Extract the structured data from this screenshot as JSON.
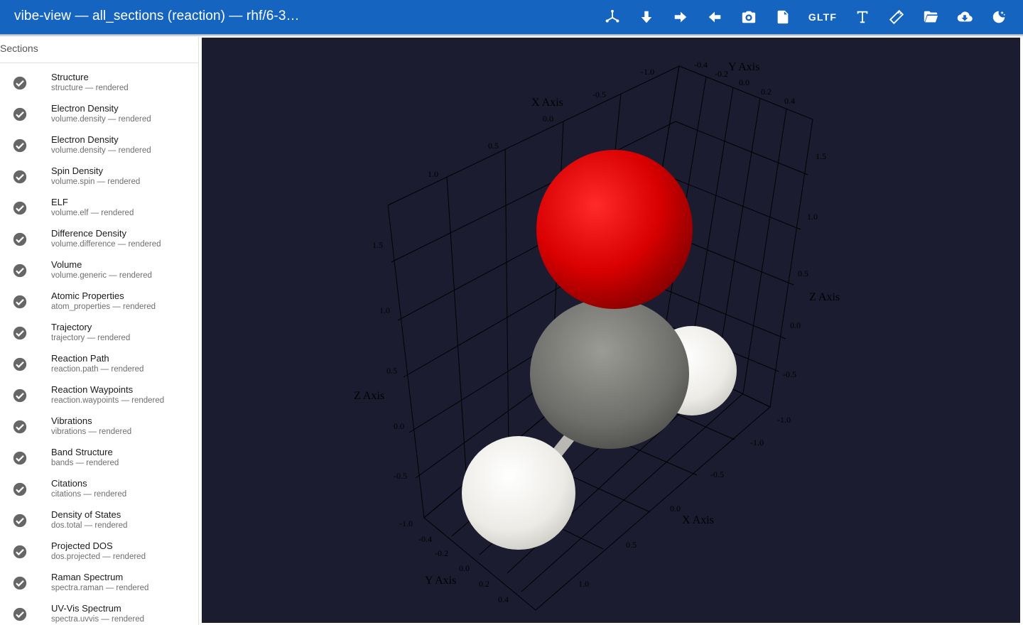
{
  "appbar": {
    "title": "vibe-view — all_sections (reaction) — rhf/6-3…",
    "toolbar": [
      {
        "name": "axes-button",
        "icon": "axes-icon"
      },
      {
        "name": "arrow-down-button",
        "icon": "arrow-down-icon"
      },
      {
        "name": "arrow-right-button",
        "icon": "arrow-right-icon"
      },
      {
        "name": "arrow-left-button",
        "icon": "arrow-left-icon"
      },
      {
        "name": "screenshot-button",
        "icon": "camera-icon"
      },
      {
        "name": "export-file-button",
        "icon": "file-export-icon"
      },
      {
        "name": "gltf-button",
        "label": "GLTF"
      },
      {
        "name": "text-button",
        "icon": "text-icon"
      },
      {
        "name": "measure-button",
        "icon": "ruler-icon"
      },
      {
        "name": "open-folder-button",
        "icon": "folder-open-icon"
      },
      {
        "name": "download-button",
        "icon": "cloud-download-icon"
      },
      {
        "name": "theme-button",
        "icon": "theme-icon"
      }
    ],
    "gltf_label": "GLTF"
  },
  "sidebar": {
    "header": "Sections",
    "items": [
      {
        "title": "Structure",
        "subtitle": "structure — rendered"
      },
      {
        "title": "Electron Density",
        "subtitle": "volume.density — rendered"
      },
      {
        "title": "Electron Density",
        "subtitle": "volume.density — rendered"
      },
      {
        "title": "Spin Density",
        "subtitle": "volume.spin — rendered"
      },
      {
        "title": "ELF",
        "subtitle": "volume.elf — rendered"
      },
      {
        "title": "Difference Density",
        "subtitle": "volume.difference — rendered"
      },
      {
        "title": "Volume",
        "subtitle": "volume.generic — rendered"
      },
      {
        "title": "Atomic Properties",
        "subtitle": "atom_properties — rendered"
      },
      {
        "title": "Trajectory",
        "subtitle": "trajectory — rendered"
      },
      {
        "title": "Reaction Path",
        "subtitle": "reaction.path — rendered"
      },
      {
        "title": "Reaction Waypoints",
        "subtitle": "reaction.waypoints — rendered"
      },
      {
        "title": "Vibrations",
        "subtitle": "vibrations — rendered"
      },
      {
        "title": "Band Structure",
        "subtitle": "bands — rendered"
      },
      {
        "title": "Citations",
        "subtitle": "citations — rendered"
      },
      {
        "title": "Density of States",
        "subtitle": "dos.total — rendered"
      },
      {
        "title": "Projected DOS",
        "subtitle": "dos.projected — rendered"
      },
      {
        "title": "Raman Spectrum",
        "subtitle": "spectra.raman — rendered"
      },
      {
        "title": "UV-Vis Spectrum",
        "subtitle": "spectra.uvvis — rendered"
      }
    ]
  },
  "viewer": {
    "background": "#1c1c30",
    "axis_titles": {
      "x": "X Axis",
      "y": "Y Axis",
      "z": "Z Axis"
    },
    "x_ticks": [
      "-1.0",
      "-0.5",
      "0.0",
      "0.5",
      "1.0"
    ],
    "y_ticks": [
      "-0.4",
      "-0.2",
      "0.0",
      "0.2",
      "0.4"
    ],
    "z_ticks": [
      "-1.0",
      "-0.5",
      "0.0",
      "0.5",
      "1.0",
      "1.5"
    ],
    "atoms": [
      {
        "element": "O",
        "color": "#e00000"
      },
      {
        "element": "C",
        "color": "#909090"
      },
      {
        "element": "H",
        "color": "#f2f2ee"
      },
      {
        "element": "H",
        "color": "#f2f2ee"
      }
    ]
  },
  "colors": {
    "appbar": "#1565c0",
    "check": "#666666"
  }
}
